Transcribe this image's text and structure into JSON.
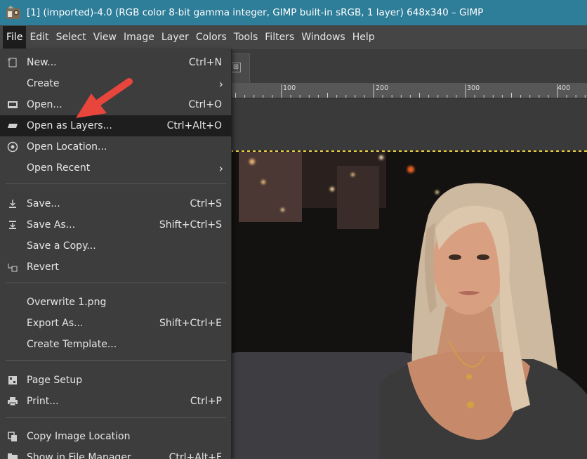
{
  "window": {
    "title": "[1] (imported)-4.0 (RGB color 8-bit gamma integer, GIMP built-in sRGB, 1 layer) 648x340 – GIMP"
  },
  "menubar": {
    "items": [
      "File",
      "Edit",
      "Select",
      "View",
      "Image",
      "Layer",
      "Colors",
      "Tools",
      "Filters",
      "Windows",
      "Help"
    ],
    "active": "File"
  },
  "tab": {
    "close_glyph": "⊠"
  },
  "ruler": {
    "labels": [
      "100",
      "200",
      "300",
      "400"
    ]
  },
  "file_menu": {
    "items": [
      {
        "label": "New...",
        "accel": "Ctrl+N",
        "icon": "new-image-icon"
      },
      {
        "label": "Create",
        "submenu": "›"
      },
      {
        "label": "Open...",
        "accel": "Ctrl+O",
        "icon": "open-icon"
      },
      {
        "label": "Open as Layers...",
        "accel": "Ctrl+Alt+O",
        "icon": "layers-icon"
      },
      {
        "label": "Open Location...",
        "icon": "location-icon"
      },
      {
        "label": "Open Recent",
        "submenu": "›"
      },
      {
        "label": "Save...",
        "accel": "Ctrl+S",
        "icon": "save-icon"
      },
      {
        "label": "Save As...",
        "accel": "Shift+Ctrl+S",
        "icon": "save-as-icon"
      },
      {
        "label": "Save a Copy..."
      },
      {
        "label": "Revert",
        "icon": "revert-icon"
      },
      {
        "label": "Overwrite 1.png"
      },
      {
        "label": "Export As...",
        "accel": "Shift+Ctrl+E"
      },
      {
        "label": "Create Template..."
      },
      {
        "label": "Page Setup",
        "icon": "page-setup-icon"
      },
      {
        "label": "Print...",
        "accel": "Ctrl+P",
        "icon": "print-icon"
      },
      {
        "label": "Copy Image Location",
        "icon": "copy-icon"
      },
      {
        "label": "Show in File Manager",
        "accel": "Ctrl+Alt+F",
        "icon": "folder-icon"
      }
    ],
    "highlighted": "Open as Layers..."
  },
  "colors": {
    "titlebar": "#2e7d99",
    "menu_bg": "#3d3d3d",
    "highlight": "#1e1e1e",
    "arrow": "#e8453c"
  }
}
